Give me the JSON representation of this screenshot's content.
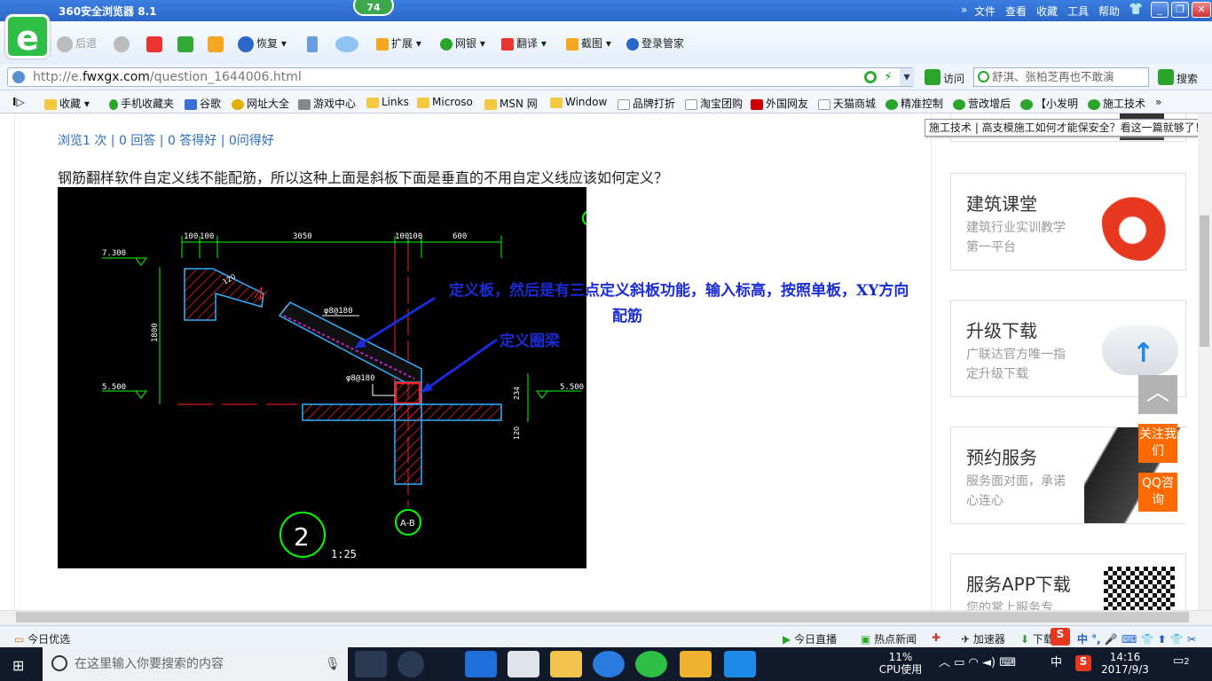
{
  "window": {
    "title": "360安全浏览器 8.1",
    "badge": "74",
    "menu": [
      "文件",
      "查看",
      "收藏",
      "工具",
      "帮助"
    ],
    "controls": {
      "minimize": "_",
      "restore": "❐",
      "close": "✕"
    }
  },
  "toolbar": {
    "back": "后退",
    "restore": "恢复",
    "extend": "扩展",
    "netbank": "网银",
    "translate": "翻译",
    "screenshot": "截图",
    "login": "登录管家"
  },
  "address": {
    "url_prefix": "http://e.",
    "url_domain": "fwxgx.com",
    "url_path": "/question_1644006.html",
    "visit": "访问",
    "search_text": "舒淇、张柏芝再也不敢演",
    "search_btn": "搜索"
  },
  "favorites": {
    "items": [
      "收藏",
      "手机收藏夹",
      "谷歌",
      "网址大全",
      "游戏中心",
      "Links",
      "Microso",
      "MSN 网",
      "Window",
      "品牌打折",
      "淘宝团购",
      "外国网友",
      "天猫商城",
      "精准控制",
      "营改增后",
      "【小发明",
      "施工技术"
    ],
    "overflow": "»"
  },
  "tooltip": "施工技术 | 高支模施工如何才能保安全？看这一篇就够了！",
  "question": {
    "stats": "浏览1 次 | 0 回答 | 0 答得好 | 0问得好",
    "text": "钢筋翻样软件自定义线不能配筋，所以这种上面是斜板下面是垂直的不用自定义线应该如何定义？"
  },
  "drawing": {
    "dims_top": [
      "100",
      "100",
      "3050",
      "100",
      "100",
      "600"
    ],
    "elev_top": "7.300",
    "elev_left": "5.500",
    "elev_right": "5.500",
    "dim_left": "1800",
    "dim_slab": "120",
    "rebar1": "φ8@180",
    "rebar2": "φ8@180",
    "dim_right1": "234",
    "dim_right2": "120",
    "circle_num": "2",
    "scale": "1:25",
    "axis": "A-B",
    "annot1_line1": "定义板，然后是有三点定义斜板功能，输入标高，按照单板，XY方向",
    "annot1_line2": "配筋",
    "annot2": "定义圈梁"
  },
  "sidebar": {
    "cards": [
      {
        "title": "建筑课堂",
        "sub": "建筑行业实训教学第一平台"
      },
      {
        "title": "升级下载",
        "sub": "广联达官方唯一指定升级下载"
      },
      {
        "title": "预约服务",
        "sub": "服务面对面，承诺心连心"
      },
      {
        "title": "服务APP下载",
        "sub": "您的掌上服务专"
      }
    ],
    "float_follow": "关注我们",
    "float_qq": "QQ咨询"
  },
  "statusbar": {
    "left": "今日优选",
    "live": "今日直播",
    "news": "热点新闻",
    "accel": "加速器",
    "download": "下载"
  },
  "taskbar": {
    "search_placeholder": "在这里输入你要搜索的内容",
    "cpu_percent": "11%",
    "cpu_label": "CPU使用",
    "ime": "中",
    "time": "14:16",
    "date": "2017/9/3",
    "notifications": "2"
  },
  "colors": {
    "title_blue": "#2b67c8",
    "link_blue": "#2b6cb8",
    "annot_blue": "#1a2cd6",
    "accent_orange": "#ff6a00",
    "cad_green": "#00ff00",
    "cad_red": "#ff2020",
    "cad_magenta": "#d020d0"
  }
}
